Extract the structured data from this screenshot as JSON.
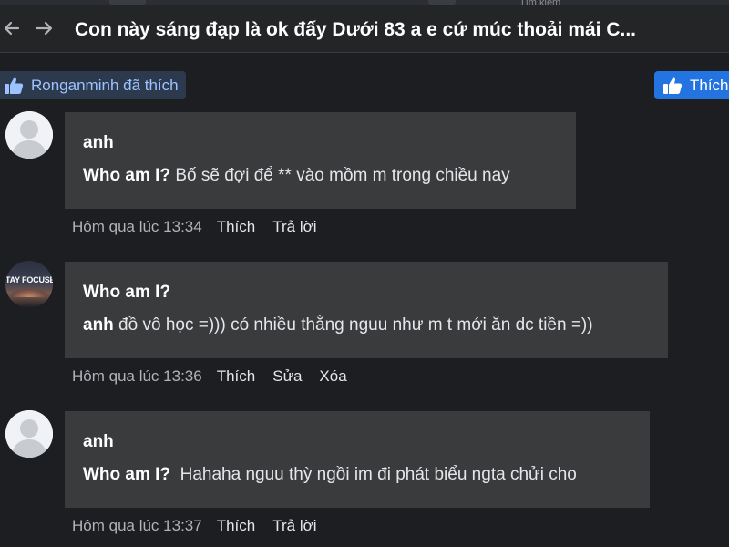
{
  "browser": {
    "search_hint": "Tìm kiếm"
  },
  "header": {
    "back_icon": "arrow-left-icon",
    "forward_icon": "arrow-right-icon",
    "title": "Con này sáng đạp là ok đấy Dưới 83 a e cứ múc thoải mái C..."
  },
  "reactions": {
    "liked_by_text": "Ronganminh đã thích",
    "like_button_label": "Thích",
    "accent_color": "#2374e1"
  },
  "comments": [
    {
      "avatar": "default-profile",
      "author": "anh",
      "mention": "Who am I?",
      "text": " Bố sẽ đợi để ** vào mồm m trong chiều nay",
      "time": "Hôm qua lúc 13:34",
      "actions": [
        "Thích",
        "Trả lời"
      ]
    },
    {
      "avatar": "photo",
      "avatar_text": "TAY FOCUSE",
      "author": "Who am I?",
      "mention": "anh",
      "text": " đồ vô học =))) có nhiều thằng nguu như m t mới ăn dc tiền =))",
      "time": "Hôm qua lúc 13:36",
      "actions": [
        "Thích",
        "Sửa",
        "Xóa"
      ]
    },
    {
      "avatar": "default-profile",
      "author": "anh",
      "mention": "Who am I?",
      "text": "  Hahaha nguu thỳ ngồi im đi phát biểu ngta chửi cho",
      "time": "Hôm qua lúc 13:37",
      "actions": [
        "Thích",
        "Trả lời"
      ]
    }
  ]
}
